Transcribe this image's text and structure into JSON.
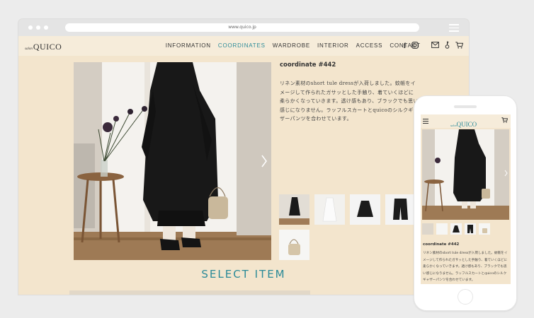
{
  "browser": {
    "url": "www.quico.jp"
  },
  "site": {
    "logo_prefix": "salon",
    "logo_name": "QUICO",
    "nav": [
      {
        "label": "INFORMATION",
        "active": false
      },
      {
        "label": "COORDINATES",
        "active": true
      },
      {
        "label": "WARDROBE",
        "active": false
      },
      {
        "label": "INTERIOR",
        "active": false
      },
      {
        "label": "ACCESS",
        "active": false
      },
      {
        "label": "CONTACT",
        "active": false
      }
    ],
    "social_icons": [
      "facebook-icon",
      "instagram-icon"
    ],
    "util_icons": [
      "mail-icon",
      "key-icon",
      "cart-icon"
    ]
  },
  "coordinate": {
    "title": "coordinate #442",
    "description": "リネン素材のshort tule dressが入荷しました。蚊帳をイメージして作られたガサッとした手触り、着ていくほどに柔らかくなっていきます。透け感もあり、ブラックでも思い感じになりません。ラッフルスカートとquicoのシルクギャザーパンツを合わせています。"
  },
  "select_item": "SELECT ITEM",
  "thumbs": [
    "coordinate-photo",
    "white-dress",
    "black-skirt",
    "black-pants",
    "basket-bag"
  ],
  "mobile": {
    "logo_prefix": "salon",
    "logo_name": "QUICO",
    "title": "coordinate #442",
    "description": "リネン素材のshort tule dressが入荷しました。蚊帳をイメージして作られたガサッとした手触り、着ていくほどに柔らかくなっていきます。透け感もあり、ブラックでも思い感じになりません。ラッフルスカートとquicoのシルクギャザーパンツを合わせています。"
  },
  "colors": {
    "accent": "#2a8a98",
    "page_bg": "#f3e5cd",
    "header_bg": "#f6ecda"
  }
}
